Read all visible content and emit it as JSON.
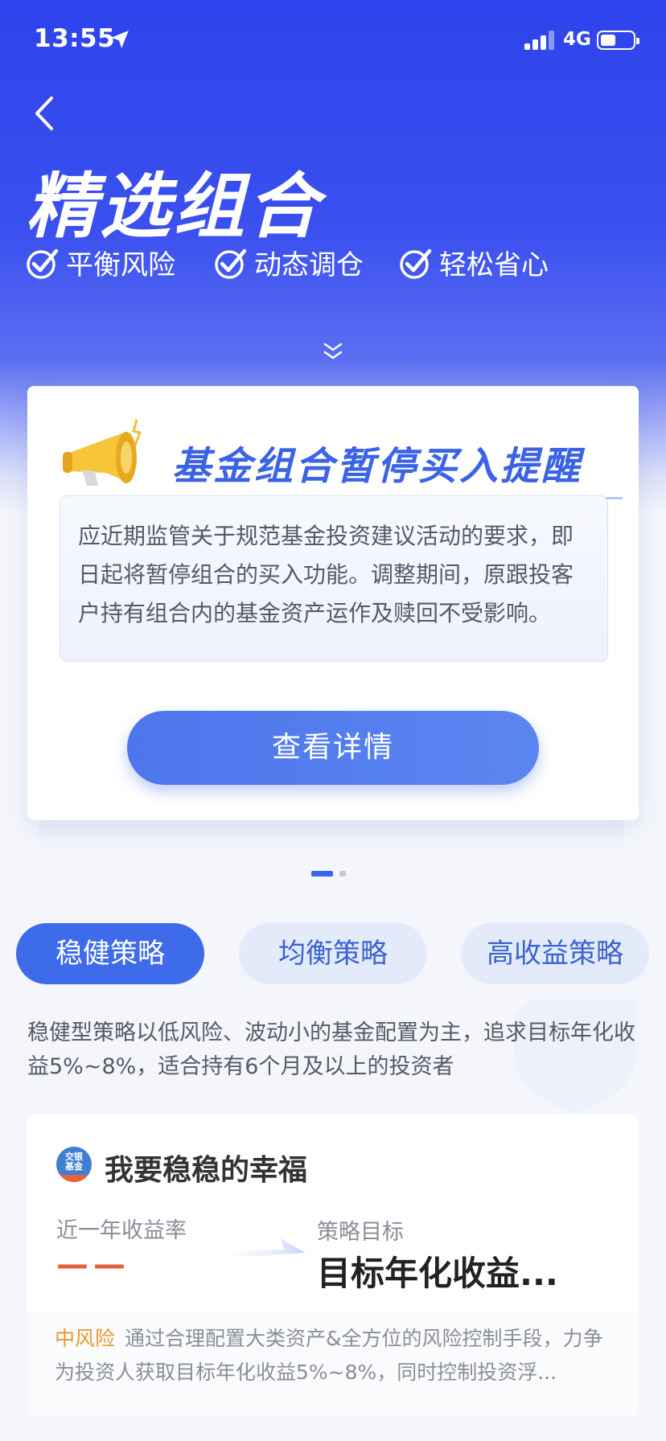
{
  "status_bar": {
    "time": "13:55",
    "network": "4G"
  },
  "header": {
    "title": "精选组合",
    "features": [
      "平衡风险",
      "动态调仓",
      "轻松省心"
    ]
  },
  "notice": {
    "title": "基金组合暂停买入提醒",
    "body": "应近期监管关于规范基金投资建议活动的要求，即日起将暂停组合的买入功能。调整期间，原跟投客户持有组合内的基金资产运作及赎回不受影响。",
    "button": "查看详情"
  },
  "carousel": {
    "count": 2,
    "active": 1
  },
  "tabs": [
    {
      "label": "稳健策略",
      "active": true
    },
    {
      "label": "均衡策略",
      "active": false
    },
    {
      "label": "高收益策略",
      "active": false
    }
  ],
  "strategy": {
    "description": "稳健型策略以低风险、波动小的基金配置为主，追求目标年化收益5%~8%，适合持有6个月及以上的投资者"
  },
  "product": {
    "logo_text": [
      "交银",
      "基金"
    ],
    "name": "我要稳稳的幸福",
    "rate_label": "近一年收益率",
    "rate_value": "——",
    "target_label": "策略目标",
    "target_value": "目标年化收益...",
    "risk": "中风险",
    "description": "通过合理配置大类资产&全方位的风险控制手段，力争为投资人获取目标年化收益5%~8%，同时控制投资浮..."
  },
  "colors": {
    "primary": "#3d6bea",
    "hero": "#2e43ec",
    "risk": "#e89a2c",
    "rate": "#e8613a"
  }
}
